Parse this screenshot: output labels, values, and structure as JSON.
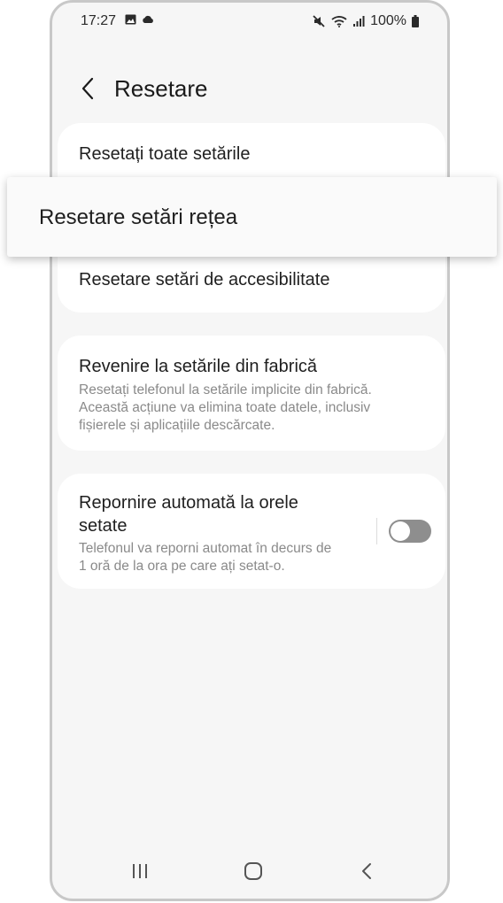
{
  "status_bar": {
    "time": "17:27",
    "battery": "100%",
    "icons": [
      "gallery-icon",
      "cloud-icon",
      "mute-icon",
      "wifi-icon",
      "signal-icon",
      "battery-icon"
    ]
  },
  "header": {
    "title": "Resetare",
    "back_icon": "chevron-left-icon"
  },
  "items": {
    "reset_all": "Resetați toate setările",
    "reset_accessibility": "Resetare setări de accesibilitate",
    "factory": {
      "title": "Revenire la setările din fabrică",
      "desc_line1": "Resetați telefonul la setările implicite din fabrică.",
      "desc_line2": "Această acțiune va elimina toate datele, inclusiv",
      "desc_line3": "fișierele și aplicațiile descărcate."
    },
    "auto_restart": {
      "title_line1": "Repornire automată la orele",
      "title_line2": "setate",
      "desc_line1": "Telefonul va reporni automat în decurs de",
      "desc_line2": "1 oră de la ora pe care ați setat-o.",
      "toggle_on": false
    }
  },
  "overlay": {
    "label": "Resetare setări rețea"
  },
  "nav": {
    "recents": "recents-icon",
    "home": "home-icon",
    "back": "back-icon"
  },
  "colors": {
    "background": "#f6f6f6",
    "card": "#ffffff",
    "text": "#1f1f1f",
    "secondary_text": "#8a8a8a",
    "toggle_off": "#8e8e8e"
  }
}
